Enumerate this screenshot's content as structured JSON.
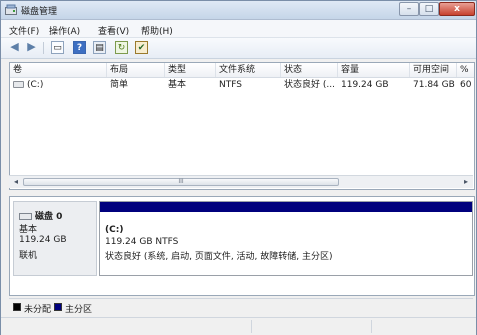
{
  "window": {
    "title": "磁盘管理",
    "min_glyph": "–",
    "max_glyph": "□",
    "close_glyph": "x"
  },
  "menu": [
    {
      "label": "文件(F)"
    },
    {
      "label": "操作(A)"
    },
    {
      "label": "查看(V)"
    },
    {
      "label": "帮助(H)"
    }
  ],
  "toolbar": {
    "icons": [
      {
        "name": "back-arrow-icon",
        "glyph": "◀"
      },
      {
        "name": "forward-arrow-icon",
        "glyph": "▶"
      },
      {
        "name": "properties-icon",
        "glyph": "▭"
      },
      {
        "name": "help-icon",
        "glyph": "?"
      },
      {
        "name": "view-grid-icon",
        "glyph": "▤"
      },
      {
        "name": "refresh-icon",
        "glyph": "↻"
      },
      {
        "name": "check-disk-icon",
        "glyph": "✔"
      }
    ]
  },
  "volume_table": {
    "headers": [
      "卷",
      "布局",
      "类型",
      "文件系统",
      "状态",
      "容量",
      "可用空间",
      "%"
    ],
    "rows": [
      {
        "volume": "(C:)",
        "layout": "简单",
        "type": "基本",
        "filesystem": "NTFS",
        "status": "状态良好 (...",
        "capacity": "119.24 GB",
        "free": "71.84 GB",
        "percent": "60"
      }
    ]
  },
  "scrollbar": {
    "left_glyph": "◂",
    "right_glyph": "▸",
    "thumb_grip": "III"
  },
  "disk": {
    "name": "磁盘 0",
    "type": "基本",
    "size": "119.24 GB",
    "state": "联机",
    "partition": {
      "label": "(C:)",
      "size_fs": "119.24 GB NTFS",
      "status": "状态良好 (系统, 启动, 页面文件, 活动, 故障转储, 主分区)",
      "bar_color": "#00007d"
    }
  },
  "legend": [
    {
      "label": "未分配",
      "color": "#000000"
    },
    {
      "label": "主分区",
      "color": "#00007d"
    }
  ]
}
